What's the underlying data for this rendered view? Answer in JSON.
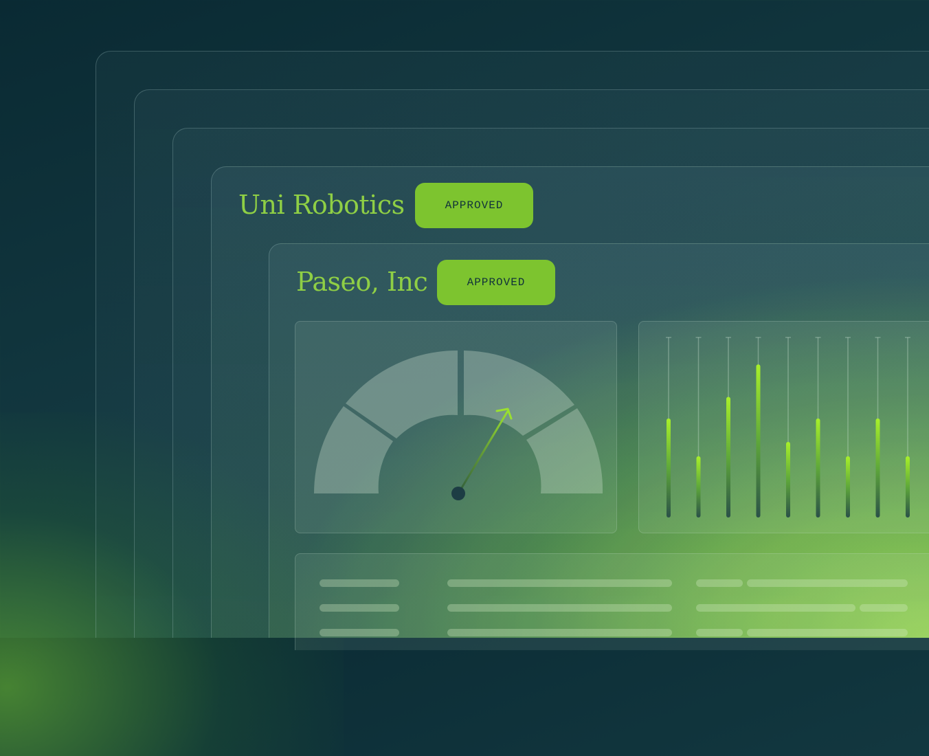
{
  "cards": [
    {
      "company": "Uni Robotics",
      "status": "APPROVED"
    },
    {
      "company": "Paseo, Inc",
      "status": "APPROVED"
    }
  ],
  "gauge": {
    "segments": 4,
    "needle_icon": "arrow-up-right-icon"
  },
  "bar_levels": [
    0.55,
    0.34,
    0.67,
    0.85,
    0.42,
    0.55,
    0.34,
    0.55,
    0.34
  ],
  "table_rows": 3,
  "colors": {
    "accent": "#7dc42f",
    "text_green": "#8fcf45",
    "badge_text": "#11323a"
  }
}
